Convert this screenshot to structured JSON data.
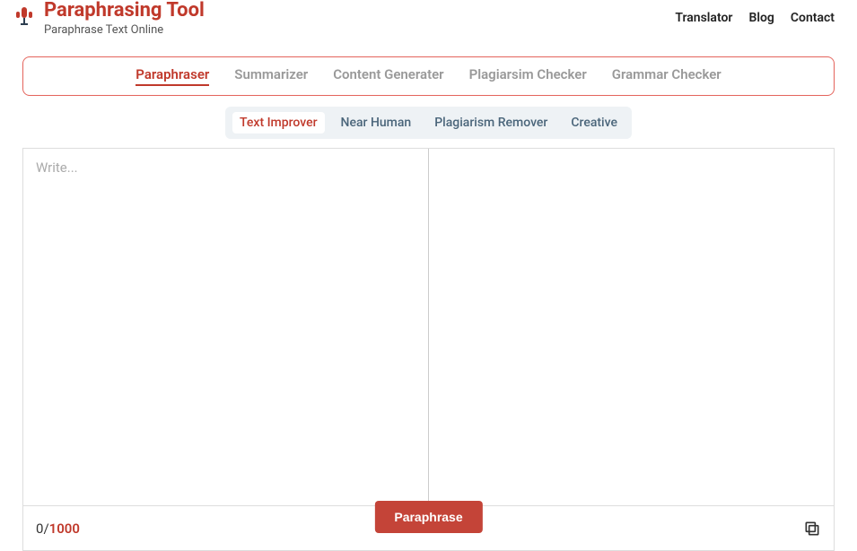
{
  "brand": {
    "title": "Paraphrasing Tool",
    "subtitle": "Paraphrase Text Online"
  },
  "nav": {
    "translator": "Translator",
    "blog": "Blog",
    "contact": "Contact"
  },
  "tabs_main": {
    "paraphraser": "Paraphraser",
    "summarizer": "Summarizer",
    "content_generater": "Content Generater",
    "plagiarism_checker": "Plagiarsim Checker",
    "grammar_checker": "Grammar Checker"
  },
  "tabs_sub": {
    "text_improver": "Text Improver",
    "near_human": "Near Human",
    "plagiarism_remover": "Plagiarism Remover",
    "creative": "Creative"
  },
  "editor": {
    "placeholder": "Write...",
    "value": ""
  },
  "counter": {
    "current": "0",
    "sep": "/",
    "max": "1000"
  },
  "actions": {
    "paraphrase": "Paraphrase"
  }
}
